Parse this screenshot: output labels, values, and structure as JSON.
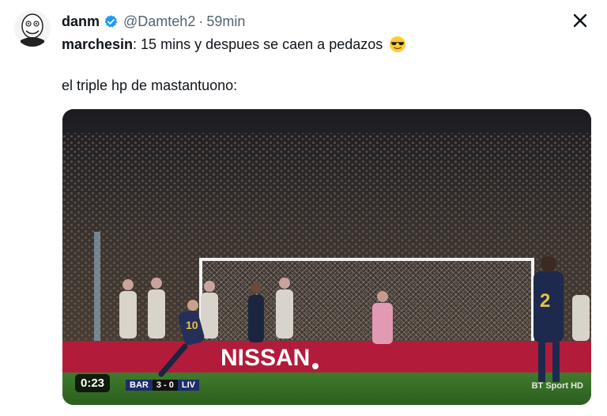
{
  "tweet": {
    "display_name": "danm",
    "handle": "@Damteh2",
    "separator": "·",
    "time": "59min",
    "quoted_user": "marchesin",
    "quoted_text": ": 15 mins y despues se caen a pedazos",
    "emoji": "smiling-face-with-sunglasses",
    "body": "el triple hp de mastantuono:"
  },
  "video": {
    "duration": "0:23",
    "score_team1": "BAR",
    "score_value": "3 - 0",
    "score_team2": "LIV",
    "ad_board_text": "NISSAN",
    "player_number_left": "10",
    "player_number_right": "2",
    "broadcaster": "BT Sport HD"
  },
  "colors": {
    "verified": "#1d9bf0",
    "secondary_text": "#536471",
    "pitch": "#3f7b2c",
    "ad_board": "#b31b3b"
  }
}
